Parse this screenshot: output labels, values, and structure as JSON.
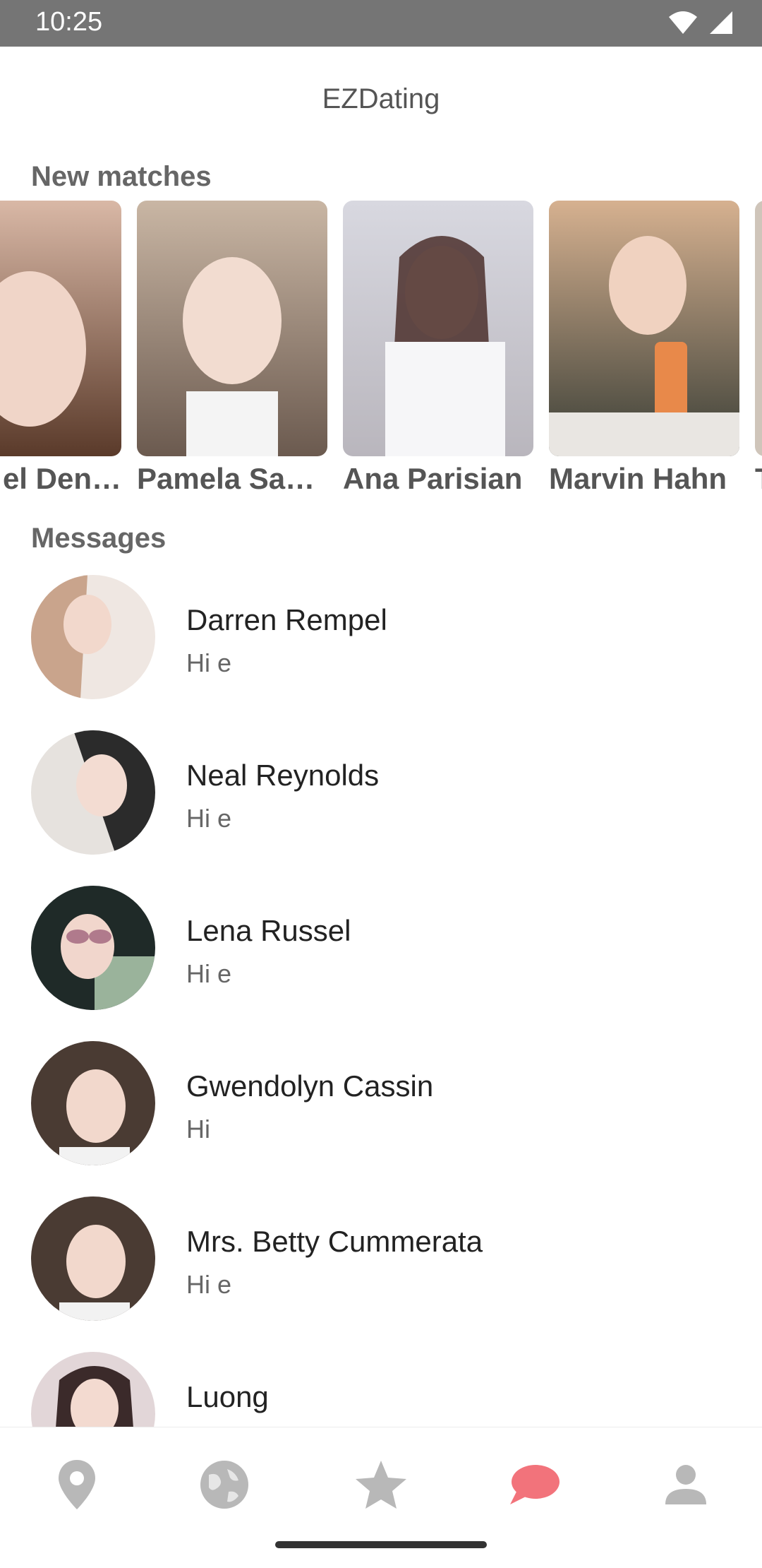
{
  "status_bar": {
    "time": "10:25"
  },
  "app": {
    "title": "EZDating"
  },
  "sections": {
    "new_matches": "New matches",
    "messages": "Messages"
  },
  "matches": [
    {
      "name": "Mabel Denesik",
      "display": "el Den…",
      "colors": [
        "#d9b8a6",
        "#5a3a2a"
      ]
    },
    {
      "name": "Pamela Sauer",
      "display": "Pamela Sau…",
      "colors": [
        "#c9b6a4",
        "#6b5a4f"
      ]
    },
    {
      "name": "Ana Parisian",
      "display": "Ana Parisian",
      "colors": [
        "#d8d8e0",
        "#4b2f2b"
      ]
    },
    {
      "name": "Marvin Hahn",
      "display": "Marvin Hahn",
      "colors": [
        "#d6b190",
        "#3a3e36"
      ]
    },
    {
      "name": "T",
      "display": "T",
      "colors": [
        "#cfc5ba",
        "#7a6a5e"
      ]
    }
  ],
  "messages": [
    {
      "name": "Darren Rempel",
      "preview": "Hi e",
      "colors": [
        "#c9a48c",
        "#efe7e2"
      ]
    },
    {
      "name": "Neal Reynolds",
      "preview": "Hi e",
      "colors": [
        "#2b2b2b",
        "#e6e2de"
      ]
    },
    {
      "name": "Lena Russel",
      "preview": "Hi e",
      "colors": [
        "#1f2a28",
        "#9ab39b"
      ]
    },
    {
      "name": "Gwendolyn Cassin",
      "preview": "Hi",
      "colors": [
        "#4a3b33",
        "#d9c3b3"
      ]
    },
    {
      "name": "Mrs. Betty Cummerata",
      "preview": "Hi e",
      "colors": [
        "#4a3b33",
        "#d9c3b3"
      ]
    },
    {
      "name": "Luong",
      "preview": "",
      "colors": [
        "#3b2a2a",
        "#e2d6d8"
      ]
    }
  ],
  "nav": {
    "items": [
      {
        "icon": "location-pin-icon",
        "active": false
      },
      {
        "icon": "globe-icon",
        "active": false
      },
      {
        "icon": "star-icon",
        "active": false
      },
      {
        "icon": "chat-bubble-icon",
        "active": true
      },
      {
        "icon": "person-icon",
        "active": false
      }
    ],
    "colors": {
      "inactive": "#b8b8b8",
      "active": "#f2737b"
    }
  }
}
